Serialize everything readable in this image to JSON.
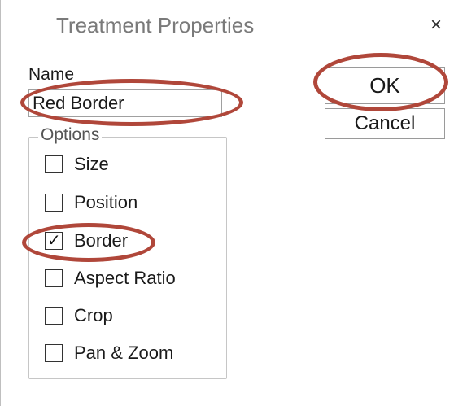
{
  "dialog": {
    "title": "Treatment Properties",
    "close_glyph": "×",
    "name_label": "Name",
    "name_value": "Red Border",
    "ok_label": "OK",
    "cancel_label": "Cancel",
    "options_legend": "Options",
    "options": [
      {
        "label": "Size",
        "checked": false
      },
      {
        "label": "Position",
        "checked": false
      },
      {
        "label": "Border",
        "checked": true
      },
      {
        "label": "Aspect Ratio",
        "checked": false
      },
      {
        "label": "Crop",
        "checked": false
      },
      {
        "label": "Pan & Zoom",
        "checked": false
      }
    ],
    "check_glyph": "✓"
  },
  "colors": {
    "annotation_circle": "#b0473a",
    "title_text": "#7a7a7a"
  },
  "icons": {
    "close": "close-icon",
    "check": "checkmark-icon"
  }
}
